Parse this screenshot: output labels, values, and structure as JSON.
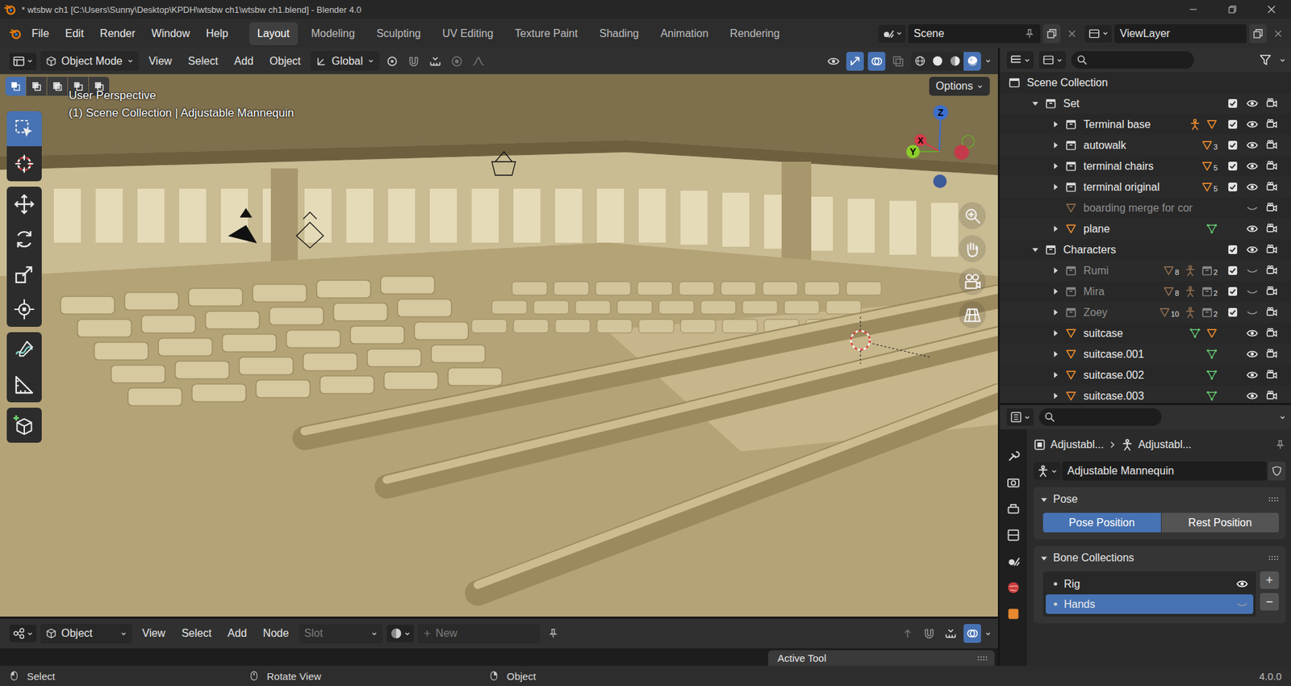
{
  "window": {
    "title": "* wtsbw ch1 [C:\\Users\\Sunny\\Desktop\\KPDH\\wtsbw ch1\\wtsbw ch1.blend] - Blender 4.0"
  },
  "menu": [
    "File",
    "Edit",
    "Render",
    "Window",
    "Help"
  ],
  "workspaces": [
    {
      "label": "Layout",
      "selected": true
    },
    {
      "label": "Modeling",
      "selected": false
    },
    {
      "label": "Sculpting",
      "selected": false
    },
    {
      "label": "UV Editing",
      "selected": false
    },
    {
      "label": "Texture Paint",
      "selected": false
    },
    {
      "label": "Shading",
      "selected": false
    },
    {
      "label": "Animation",
      "selected": false
    },
    {
      "label": "Rendering",
      "selected": false
    }
  ],
  "scene": {
    "label": "Scene"
  },
  "view_layer": {
    "label": "ViewLayer"
  },
  "viewport": {
    "mode": "Object Mode",
    "menus": [
      "View",
      "Select",
      "Add",
      "Object"
    ],
    "orientation": "Global",
    "left_toggles": [
      {
        "kind": "pivot",
        "on": false
      },
      {
        "kind": "snap",
        "on": false
      },
      {
        "kind": "snap-target",
        "on": false
      },
      {
        "kind": "proportional",
        "on": false
      },
      {
        "kind": "falloff",
        "on": false
      }
    ],
    "right_toggles": [
      {
        "kind": "visibility",
        "on": false
      },
      {
        "kind": "gizmo",
        "on": true
      },
      {
        "kind": "overlay",
        "on": true
      },
      {
        "kind": "xray",
        "on": false
      }
    ],
    "shading": [
      {
        "kind": "wireframe",
        "selected": false
      },
      {
        "kind": "solid",
        "selected": false
      },
      {
        "kind": "material",
        "selected": false
      },
      {
        "kind": "rendered",
        "selected": true
      }
    ],
    "select_modes": [
      {
        "selected": true
      },
      {
        "selected": false
      },
      {
        "selected": false
      },
      {
        "selected": false
      },
      {
        "selected": false
      }
    ],
    "info": [
      "User Perspective",
      "(1) Scene Collection | Adjustable Mannequin"
    ],
    "options": "Options",
    "gizmo": {
      "x": "X",
      "y": "Y",
      "z": "Z"
    },
    "tools": [
      {
        "kind": "select",
        "selected": true
      },
      {
        "kind": "cursor",
        "selected": false
      },
      {
        "kind": "move",
        "selected": false
      },
      {
        "kind": "rotate",
        "selected": false
      },
      {
        "kind": "scale",
        "selected": false
      },
      {
        "kind": "transform",
        "selected": false
      },
      {
        "kind": "annotate",
        "selected": false
      },
      {
        "kind": "measure",
        "selected": false
      },
      {
        "kind": "add-cube",
        "selected": false
      }
    ]
  },
  "outliner": {
    "rows": [
      {
        "label": "Scene Collection",
        "depth": 0,
        "kind": "scene",
        "expandable": false,
        "expanded": false,
        "greyed": false,
        "badges": []
      },
      {
        "label": "Set",
        "depth": 1,
        "kind": "collection",
        "expandable": true,
        "expanded": true,
        "greyed": false,
        "checked": true,
        "visible": true,
        "renderable": true,
        "badges": []
      },
      {
        "label": "Terminal base",
        "depth": 2,
        "kind": "collection",
        "expandable": true,
        "expanded": false,
        "greyed": false,
        "checked": true,
        "visible": true,
        "renderable": true,
        "badges": [
          {
            "kind": "armature",
            "count": ""
          },
          {
            "kind": "mesh",
            "count": ""
          }
        ]
      },
      {
        "label": "autowalk",
        "depth": 2,
        "kind": "collection",
        "expandable": true,
        "expanded": false,
        "greyed": false,
        "checked": true,
        "visible": true,
        "renderable": true,
        "badges": [
          {
            "kind": "mesh",
            "count": "3"
          }
        ]
      },
      {
        "label": "terminal chairs",
        "depth": 2,
        "kind": "collection",
        "expandable": true,
        "expanded": false,
        "greyed": false,
        "checked": true,
        "visible": true,
        "renderable": true,
        "badges": [
          {
            "kind": "mesh",
            "count": "5"
          }
        ]
      },
      {
        "label": "terminal original",
        "depth": 2,
        "kind": "collection",
        "expandable": true,
        "expanded": false,
        "greyed": false,
        "checked": true,
        "visible": true,
        "renderable": true,
        "badges": [
          {
            "kind": "mesh",
            "count": "5"
          }
        ]
      },
      {
        "label": "boarding merge for cor",
        "depth": 2,
        "kind": "mesh",
        "expandable": false,
        "expanded": false,
        "greyed": true,
        "visible": false,
        "renderable": true,
        "badges": []
      },
      {
        "label": "plane",
        "depth": 2,
        "kind": "mesh",
        "expandable": true,
        "expanded": false,
        "greyed": false,
        "visible": true,
        "renderable": true,
        "badges": [
          {
            "kind": "data",
            "count": ""
          }
        ]
      },
      {
        "label": "Characters",
        "depth": 1,
        "kind": "collection",
        "expandable": true,
        "expanded": true,
        "greyed": false,
        "checked": true,
        "visible": true,
        "renderable": true,
        "badges": []
      },
      {
        "label": "Rumi",
        "depth": 2,
        "kind": "collection",
        "expandable": true,
        "expanded": false,
        "greyed": true,
        "checked": true,
        "visible": false,
        "renderable": true,
        "badges": [
          {
            "kind": "mesh",
            "count": "8"
          },
          {
            "kind": "armature",
            "count": ""
          },
          {
            "kind": "collection",
            "count": "2"
          }
        ]
      },
      {
        "label": "Mira",
        "depth": 2,
        "kind": "collection",
        "expandable": true,
        "expanded": false,
        "greyed": true,
        "checked": true,
        "visible": false,
        "renderable": true,
        "badges": [
          {
            "kind": "mesh",
            "count": "8"
          },
          {
            "kind": "armature",
            "count": ""
          },
          {
            "kind": "collection",
            "count": "2"
          }
        ]
      },
      {
        "label": "Zoey",
        "depth": 2,
        "kind": "collection",
        "expandable": true,
        "expanded": false,
        "greyed": true,
        "checked": true,
        "visible": false,
        "renderable": true,
        "badges": [
          {
            "kind": "mesh",
            "count": "10"
          },
          {
            "kind": "armature",
            "count": ""
          },
          {
            "kind": "collection",
            "count": "2"
          }
        ]
      },
      {
        "label": "suitcase",
        "depth": 2,
        "kind": "mesh",
        "expandable": true,
        "expanded": false,
        "greyed": false,
        "visible": true,
        "renderable": true,
        "badges": [
          {
            "kind": "data",
            "count": ""
          },
          {
            "kind": "mesh",
            "count": ""
          }
        ]
      },
      {
        "label": "suitcase.001",
        "depth": 2,
        "kind": "mesh",
        "expandable": true,
        "expanded": false,
        "greyed": false,
        "visible": true,
        "renderable": true,
        "badges": [
          {
            "kind": "data",
            "count": ""
          }
        ]
      },
      {
        "label": "suitcase.002",
        "depth": 2,
        "kind": "mesh",
        "expandable": true,
        "expanded": false,
        "greyed": false,
        "visible": true,
        "renderable": true,
        "badges": [
          {
            "kind": "data",
            "count": ""
          }
        ]
      },
      {
        "label": "suitcase.003",
        "depth": 2,
        "kind": "mesh",
        "expandable": true,
        "expanded": false,
        "greyed": false,
        "visible": true,
        "renderable": true,
        "badges": [
          {
            "kind": "data",
            "count": ""
          }
        ]
      }
    ]
  },
  "properties": {
    "tabs": [
      {
        "kind": "tool"
      },
      {
        "kind": "render"
      },
      {
        "kind": "output"
      },
      {
        "kind": "view-layer"
      },
      {
        "kind": "scene"
      },
      {
        "kind": "world"
      },
      {
        "kind": "object"
      }
    ],
    "breadcrumb": [
      "Adjustabl...",
      "Adjustabl..."
    ],
    "name": "Adjustable Mannequin",
    "pose": {
      "title": "Pose",
      "options": [
        {
          "label": "Pose Position",
          "selected": true
        },
        {
          "label": "Rest Position",
          "selected": false
        }
      ]
    },
    "bone_collections": {
      "title": "Bone Collections",
      "items": [
        {
          "label": "Rig",
          "selected": false,
          "visible": true
        },
        {
          "label": "Hands",
          "selected": true,
          "visible": false
        }
      ],
      "add": "+",
      "remove": "−"
    }
  },
  "node_editor": {
    "editor": "Object",
    "menus": [
      "View",
      "Select",
      "Add",
      "Node"
    ],
    "slot": {
      "label": "Slot",
      "disabled": true
    },
    "new": {
      "label": "New",
      "disabled": true
    },
    "panel": "Active Tool"
  },
  "status_bar": {
    "items": [
      "Select",
      "Rotate View",
      "Object"
    ],
    "version": "4.0.0"
  }
}
